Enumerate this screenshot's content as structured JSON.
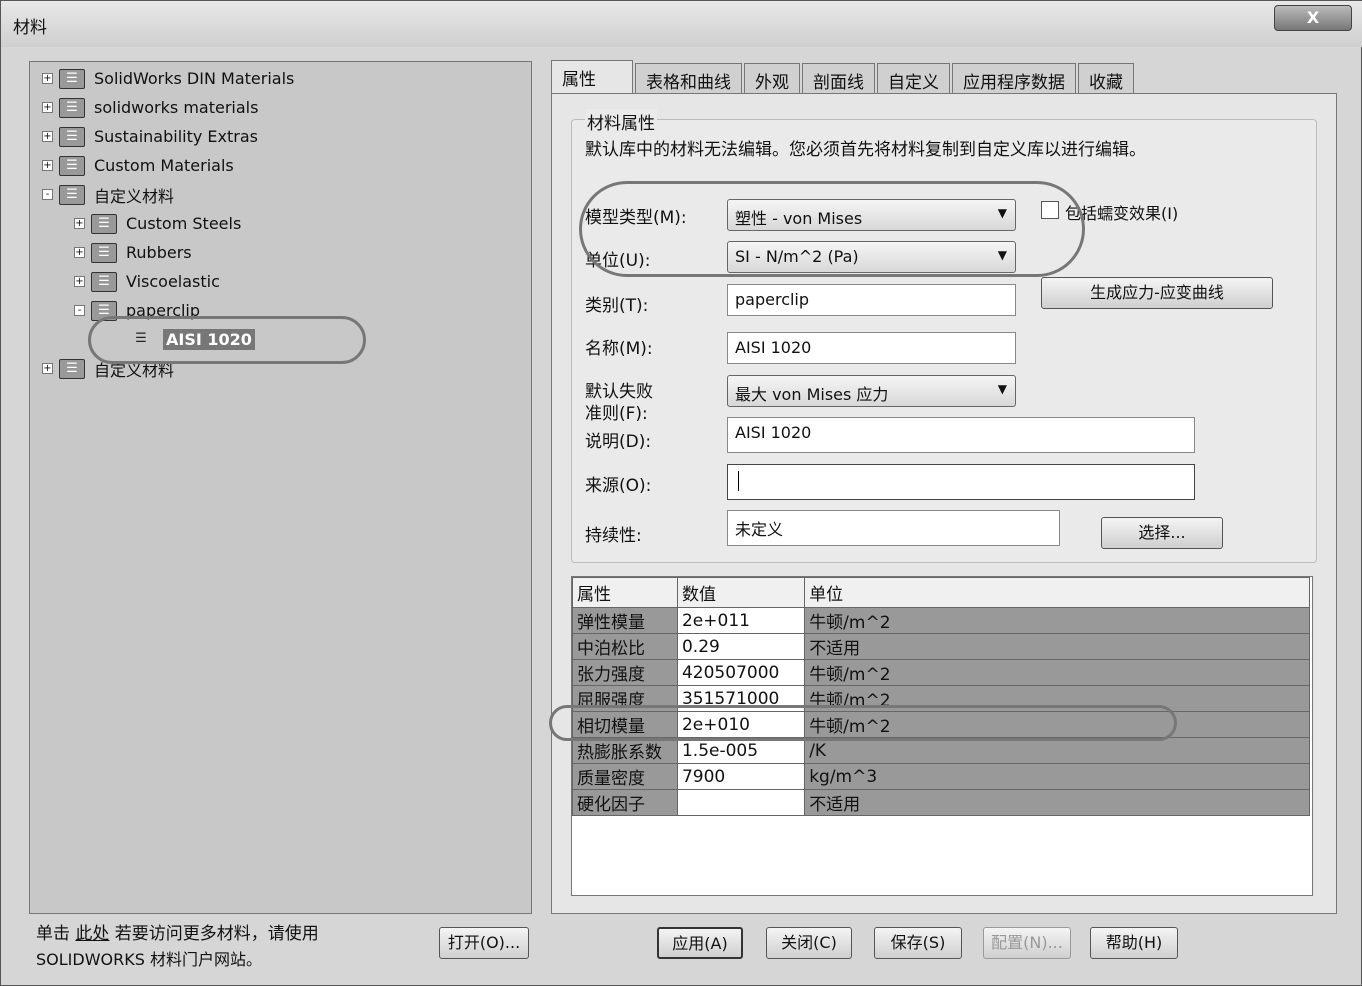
{
  "window": {
    "title": "材料",
    "close": "X"
  },
  "tree": [
    {
      "label": "SolidWorks DIN Materials",
      "level": 0,
      "expander": "+"
    },
    {
      "label": "solidworks materials",
      "level": 0,
      "expander": "+"
    },
    {
      "label": "Sustainability Extras",
      "level": 0,
      "expander": "+"
    },
    {
      "label": "Custom Materials",
      "level": 0,
      "expander": "+"
    },
    {
      "label": "自定义材料",
      "level": 0,
      "expander": "-"
    },
    {
      "label": "Custom Steels",
      "level": 1,
      "expander": "+"
    },
    {
      "label": "Rubbers",
      "level": 1,
      "expander": "+"
    },
    {
      "label": "Viscoelastic",
      "level": 1,
      "expander": "+"
    },
    {
      "label": "paperclip",
      "level": 1,
      "expander": "-"
    },
    {
      "label": "AISI 1020",
      "level": 2,
      "expander": "",
      "selected": true
    },
    {
      "label": "自定义材料",
      "level": 0,
      "expander": "+"
    }
  ],
  "tabs": [
    "属性",
    "表格和曲线",
    "外观",
    "剖面线",
    "自定义",
    "应用程序数据",
    "收藏"
  ],
  "props": {
    "group_title": "材料属性",
    "notice": "默认库中的材料无法编辑。您必须首先将材料复制到自定义库以进行编辑。",
    "model_type_label": "模型类型(M):",
    "model_type": "塑性 - von Mises",
    "creep_label": "包括蠕变效果(I)",
    "units_label": "单位(U):",
    "units": "SI - N/m^2 (Pa)",
    "category_label": "类别(T):",
    "category": "paperclip",
    "stress_strain_button": "生成应力-应变曲线",
    "name_label": "名称(M):",
    "name": "AISI 1020",
    "failure_label_1": "默认失败",
    "failure_label_2": "准则(F):",
    "failure": "最大 von Mises 应力",
    "desc_label": "说明(D):",
    "desc": "AISI 1020",
    "source_label": "来源(O):",
    "source": "",
    "sustain_label": "持续性:",
    "sustain": "未定义",
    "select_button": "选择..."
  },
  "table": {
    "headers": [
      "属性",
      "数值",
      "单位"
    ],
    "rows": [
      [
        "弹性模量",
        "2e+011",
        "牛顿/m^2"
      ],
      [
        "中泊松比",
        "0.29",
        "不适用"
      ],
      [
        "张力强度",
        "420507000",
        "牛顿/m^2"
      ],
      [
        "屈服强度",
        "351571000",
        "牛顿/m^2"
      ],
      [
        "相切模量",
        "2e+010",
        "牛顿/m^2"
      ],
      [
        "热膨胀系数",
        "1.5e-005",
        "/K"
      ],
      [
        "质量密度",
        "7900",
        "kg/m^3"
      ],
      [
        "硬化因子",
        "",
        "不适用"
      ]
    ]
  },
  "footer": {
    "hint_prefix": "单击 ",
    "hint_link": "此处",
    "hint_suffix": " 若要访问更多材料，请使用",
    "hint_line2": "SOLIDWORKS 材料门户网站。",
    "open": "打开(O)...",
    "apply": "应用(A)",
    "close": "关闭(C)",
    "save": "保存(S)",
    "config": "配置(N)...",
    "help": "帮助(H)"
  }
}
